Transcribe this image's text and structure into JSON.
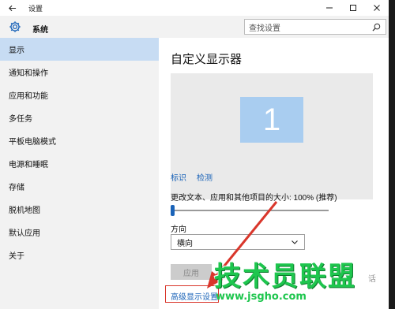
{
  "window": {
    "title": "设置",
    "section": "系统"
  },
  "search": {
    "placeholder": "查找设置"
  },
  "sidebar": {
    "items": [
      {
        "label": "显示",
        "active": true
      },
      {
        "label": "通知和操作"
      },
      {
        "label": "应用和功能"
      },
      {
        "label": "多任务"
      },
      {
        "label": "平板电脑模式"
      },
      {
        "label": "电源和睡眠"
      },
      {
        "label": "存储"
      },
      {
        "label": "脱机地图"
      },
      {
        "label": "默认应用"
      },
      {
        "label": "关于"
      }
    ]
  },
  "main": {
    "title": "自定义显示器",
    "monitor_number": "1",
    "links": [
      "标识",
      "检测"
    ],
    "scale_label": "更改文本、应用和其他项目的大小: 100% (推荐)",
    "scale_value_percent": 100,
    "orientation_label": "方向",
    "orientation_value": "横向",
    "apply_label": "应用",
    "advanced_link": "高级显示设置"
  },
  "watermark": {
    "big": "技术员联盟",
    "small": "www.jsgho.com",
    "ext": "话"
  },
  "colors": {
    "accent": "#1a63b8",
    "active_nav": "#c7dcf3",
    "monitor": "#a9cdf0",
    "arrow": "#d9362b",
    "watermark": "#1ec64e"
  },
  "icons": {
    "back": "back-arrow-icon",
    "settings": "gear-icon",
    "search": "search-icon",
    "minimize": "minimize-icon",
    "maximize": "maximize-icon",
    "close": "close-icon",
    "dropdown": "chevron-down-icon"
  }
}
